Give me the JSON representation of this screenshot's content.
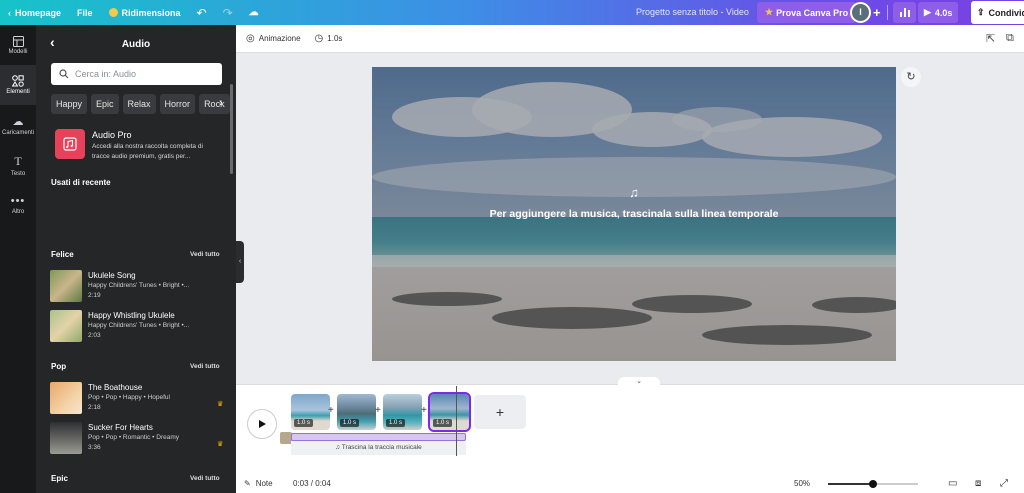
{
  "topbar": {
    "home_label": "Homepage",
    "file_label": "File",
    "resize_label": "Ridimensiona",
    "doc_title": "Progetto senza titolo - Video",
    "pro_label": "Prova Canva Pro",
    "avatar_initial": "I",
    "play_label": "4.0s",
    "share_label": "Condividi"
  },
  "rail": [
    {
      "label": "Modelli",
      "icon": "template-icon"
    },
    {
      "label": "Elementi",
      "icon": "elements-icon",
      "active": true
    },
    {
      "label": "Caricamenti",
      "icon": "upload-icon"
    },
    {
      "label": "Testo",
      "icon": "text-icon"
    },
    {
      "label": "Altro",
      "icon": "more-icon"
    }
  ],
  "panel": {
    "title": "Audio",
    "search_placeholder": "Cerca in: Audio",
    "chips": [
      "Happy",
      "Epic",
      "Relax",
      "Horror",
      "Rock"
    ],
    "promo": {
      "title": "Audio Pro",
      "desc": "Accedi alla nostra raccolta completa di tracce audio premium, gratis per..."
    },
    "recent_title": "Usati di recente",
    "see_all": "Vedi tutto",
    "sections": [
      {
        "title": "Felice",
        "tracks": [
          {
            "name": "Ukulele Song",
            "sub": "Happy Childrens' Tunes • Bright •...",
            "dur": "2:19"
          },
          {
            "name": "Happy Whistling Ukulele",
            "sub": "Happy Childrens' Tunes • Bright •...",
            "dur": "2:03"
          }
        ]
      },
      {
        "title": "Pop",
        "tracks": [
          {
            "name": "The Boathouse",
            "sub": "Pop • Pop • Happy • Hopeful",
            "dur": "2:18"
          },
          {
            "name": "Sucker For Hearts",
            "sub": "Pop • Pop • Romantic • Dreamy",
            "dur": "3:36"
          }
        ]
      },
      {
        "title": "Epic",
        "tracks": []
      }
    ]
  },
  "toolbar": {
    "animation_label": "Animazione",
    "duration_label": "1.0s"
  },
  "canvas": {
    "message": "Per aggiungere la musica, trascinala sulla linea temporale"
  },
  "timeline": {
    "clips": [
      {
        "label": "1.0 s"
      },
      {
        "label": "1.0 s"
      },
      {
        "label": "1.0 s"
      },
      {
        "label": "1.0 s",
        "selected": true
      }
    ],
    "audio_hint": "♫ Trascina la traccia musicale"
  },
  "bottombar": {
    "notes_label": "Note",
    "time": "0:03 / 0:04",
    "zoom": "50%",
    "zoom_fraction": 0.5
  }
}
